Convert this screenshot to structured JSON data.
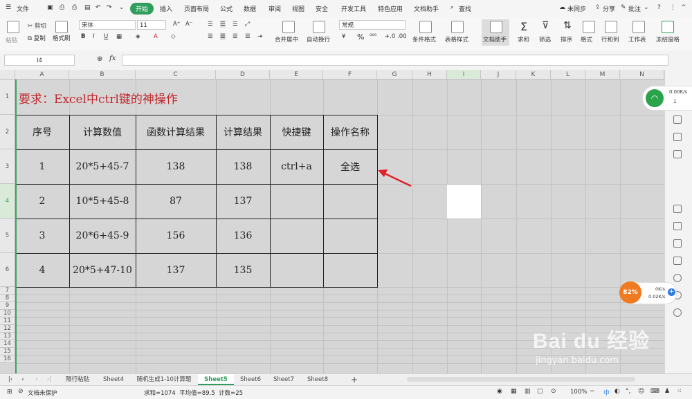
{
  "menu": {
    "file": "文件",
    "tabs": [
      "开始",
      "插入",
      "页面布局",
      "公式",
      "数据",
      "审阅",
      "视图",
      "安全",
      "开发工具",
      "特色应用",
      "文档助手"
    ],
    "search": "查找",
    "sync": "未同步",
    "share": "分享",
    "comment": "批注"
  },
  "ribbon": {
    "paste": "粘贴",
    "cut": "剪切",
    "copy": "复制",
    "format_painter": "格式刷",
    "font_name": "宋体",
    "font_size": "11",
    "merge_center": "合并居中",
    "wrap_text": "自动换行",
    "number_format": "常规",
    "cond_format": "条件格式",
    "table_style": "表格样式",
    "doc_helper": "文档助手",
    "sum": "求和",
    "filter": "筛选",
    "sort": "排序",
    "format": "格式",
    "row_col": "行和列",
    "worksheet": "工作表",
    "freeze": "冻结窗格"
  },
  "formula_bar": {
    "name_box": "I4",
    "fx": "fx",
    "value": ""
  },
  "columns": [
    "A",
    "B",
    "C",
    "D",
    "E",
    "F",
    "G",
    "H",
    "I",
    "J",
    "K",
    "L",
    "M",
    "N"
  ],
  "rows": [
    "1",
    "2",
    "3",
    "4",
    "5",
    "6",
    "7",
    "8",
    "9",
    "10",
    "11",
    "12",
    "13",
    "14",
    "15",
    "16"
  ],
  "sheet": {
    "title": "要求：Excel中ctrl键的神操作",
    "headers": [
      "序号",
      "计算数值",
      "函数计算结果",
      "计算结果",
      "快捷键",
      "操作名称"
    ],
    "data": [
      [
        "1",
        "20*5+45-7",
        "138",
        "138",
        "ctrl+a",
        "全选"
      ],
      [
        "2",
        "10*5+45-8",
        "87",
        "137",
        "",
        ""
      ],
      [
        "3",
        "20*6+45-9",
        "156",
        "136",
        "",
        ""
      ],
      [
        "4",
        "20*5+47-10",
        "137",
        "135",
        "",
        ""
      ]
    ]
  },
  "tabs": [
    "隔行粘贴",
    "Sheet4",
    "随机生成1-10计算题",
    "Sheet5",
    "Sheet6",
    "Sheet7",
    "Sheet8"
  ],
  "active_tab": "Sheet5",
  "status": {
    "protect": "文档未保护",
    "stats": "求和=1074  平均值=89.5  计数=25",
    "zoom": "100%"
  },
  "widgets": {
    "net_up": "0.00K/s",
    "net_count": "1",
    "cpu": "82%",
    "speed_up": "0K/s",
    "speed_down": "0.02K/s"
  },
  "watermark": {
    "logo": "Bai du 经验",
    "url": "jingyan.baidu.com"
  },
  "colors": {
    "accent": "#2f9e5c",
    "title_red": "#c0282d",
    "grid_bg": "#d6d6d6"
  }
}
